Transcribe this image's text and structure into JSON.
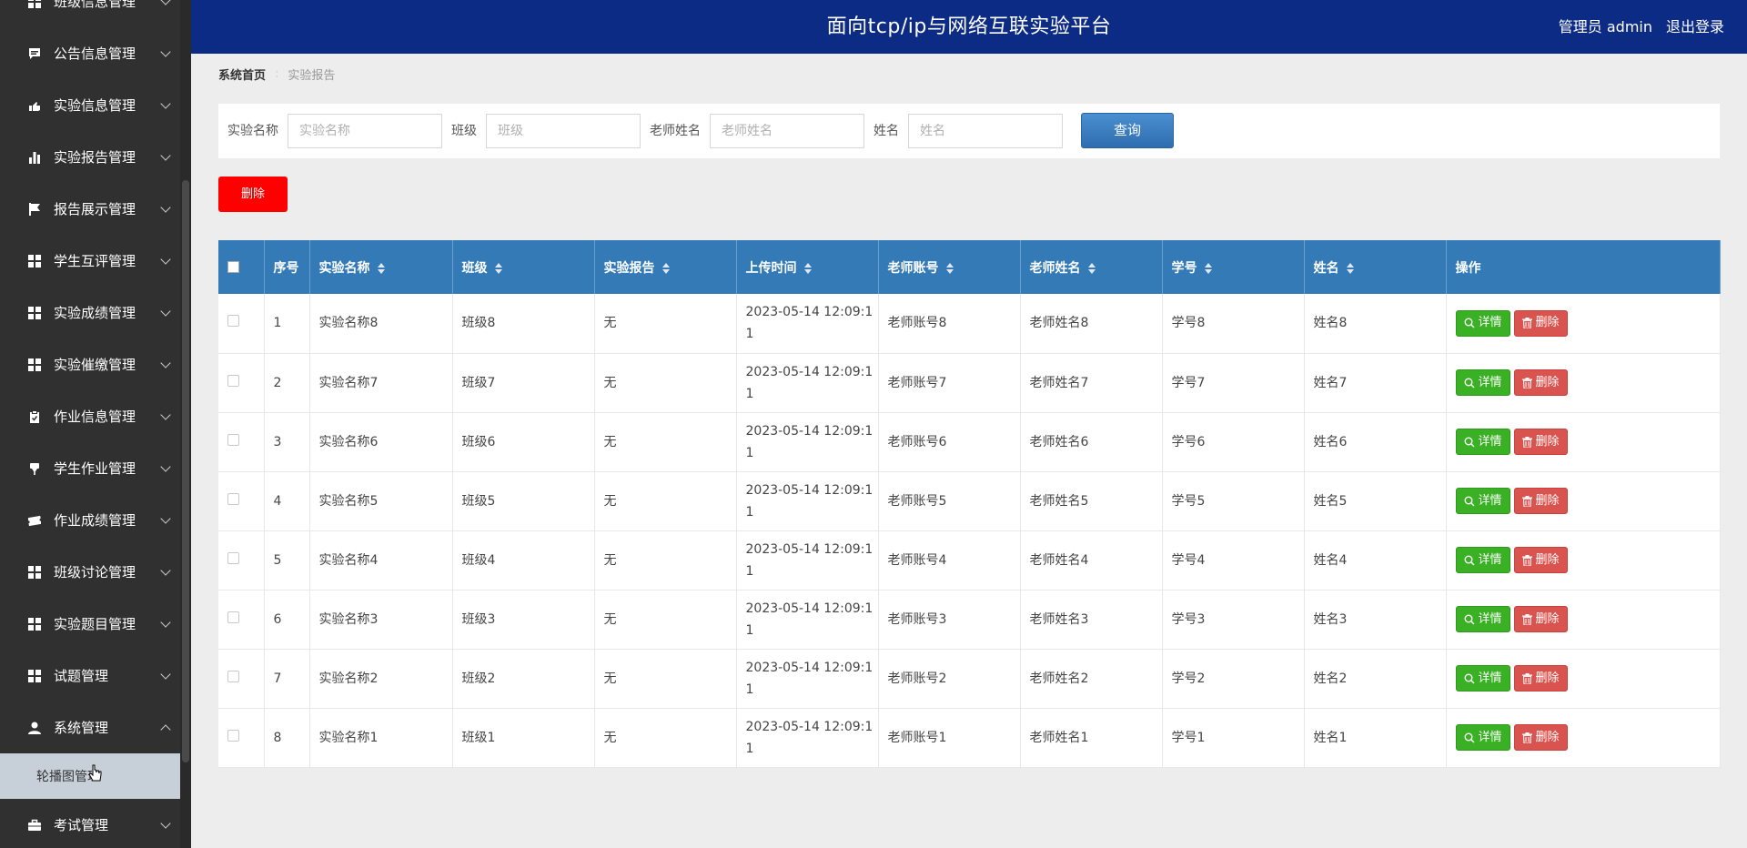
{
  "header": {
    "title": "面向tcp/ip与网络互联实验平台",
    "user": "管理员 admin",
    "logout": "退出登录"
  },
  "sidebar": {
    "items": [
      {
        "label": "班级信息管理",
        "icon": "grid-icon"
      },
      {
        "label": "公告信息管理",
        "icon": "chat-icon"
      },
      {
        "label": "实验信息管理",
        "icon": "hand-icon"
      },
      {
        "label": "实验报告管理",
        "icon": "bar-chart-icon"
      },
      {
        "label": "报告展示管理",
        "icon": "flag-icon"
      },
      {
        "label": "学生互评管理",
        "icon": "grid-icon"
      },
      {
        "label": "实验成绩管理",
        "icon": "grid-icon"
      },
      {
        "label": "实验催缴管理",
        "icon": "grid-icon"
      },
      {
        "label": "作业信息管理",
        "icon": "clipboard-icon"
      },
      {
        "label": "学生作业管理",
        "icon": "pushpin-icon"
      },
      {
        "label": "作业成绩管理",
        "icon": "ticket-icon"
      },
      {
        "label": "班级讨论管理",
        "icon": "grid-icon"
      },
      {
        "label": "实验题目管理",
        "icon": "grid-icon"
      },
      {
        "label": "试题管理",
        "icon": "grid-icon"
      },
      {
        "label": "系统管理",
        "icon": "user-icon",
        "expanded": true
      }
    ],
    "submenu": {
      "label": "轮播图管理"
    },
    "after": {
      "label": "考试管理",
      "icon": "briefcase-icon"
    }
  },
  "breadcrumb": {
    "home": "系统首页",
    "current": "实验报告"
  },
  "search": {
    "fields": [
      {
        "label": "实验名称",
        "placeholder": "实验名称"
      },
      {
        "label": "班级",
        "placeholder": "班级"
      },
      {
        "label": "老师姓名",
        "placeholder": "老师姓名"
      },
      {
        "label": "姓名",
        "placeholder": "姓名"
      }
    ],
    "query_button": "查询"
  },
  "toolbar": {
    "delete_label": "删除"
  },
  "table": {
    "headers": [
      "序号",
      "实验名称",
      "班级",
      "实验报告",
      "上传时间",
      "老师账号",
      "老师姓名",
      "学号",
      "姓名",
      "操作"
    ],
    "detail_label": "详情",
    "delete_label": "删除",
    "rows": [
      {
        "no": "1",
        "name": "实验名称8",
        "cls": "班级8",
        "report": "无",
        "time1": "2023-05-14 12:09:1",
        "time2": "1",
        "tacct": "老师账号8",
        "tname": "老师姓名8",
        "sno": "学号8",
        "sname": "姓名8"
      },
      {
        "no": "2",
        "name": "实验名称7",
        "cls": "班级7",
        "report": "无",
        "time1": "2023-05-14 12:09:1",
        "time2": "1",
        "tacct": "老师账号7",
        "tname": "老师姓名7",
        "sno": "学号7",
        "sname": "姓名7"
      },
      {
        "no": "3",
        "name": "实验名称6",
        "cls": "班级6",
        "report": "无",
        "time1": "2023-05-14 12:09:1",
        "time2": "1",
        "tacct": "老师账号6",
        "tname": "老师姓名6",
        "sno": "学号6",
        "sname": "姓名6"
      },
      {
        "no": "4",
        "name": "实验名称5",
        "cls": "班级5",
        "report": "无",
        "time1": "2023-05-14 12:09:1",
        "time2": "1",
        "tacct": "老师账号5",
        "tname": "老师姓名5",
        "sno": "学号5",
        "sname": "姓名5"
      },
      {
        "no": "5",
        "name": "实验名称4",
        "cls": "班级4",
        "report": "无",
        "time1": "2023-05-14 12:09:1",
        "time2": "1",
        "tacct": "老师账号4",
        "tname": "老师姓名4",
        "sno": "学号4",
        "sname": "姓名4"
      },
      {
        "no": "6",
        "name": "实验名称3",
        "cls": "班级3",
        "report": "无",
        "time1": "2023-05-14 12:09:1",
        "time2": "1",
        "tacct": "老师账号3",
        "tname": "老师姓名3",
        "sno": "学号3",
        "sname": "姓名3"
      },
      {
        "no": "7",
        "name": "实验名称2",
        "cls": "班级2",
        "report": "无",
        "time1": "2023-05-14 12:09:1",
        "time2": "1",
        "tacct": "老师账号2",
        "tname": "老师姓名2",
        "sno": "学号2",
        "sname": "姓名2"
      },
      {
        "no": "8",
        "name": "实验名称1",
        "cls": "班级1",
        "report": "无",
        "time1": "2023-05-14 12:09:1",
        "time2": "1",
        "tacct": "老师账号1",
        "tname": "老师姓名1",
        "sno": "学号1",
        "sname": "姓名1"
      }
    ]
  },
  "colors": {
    "header_bg": "#0c2b84",
    "sidebar_bg": "#303030",
    "table_header_bg": "#337ab7",
    "detail_green": "#3ab025",
    "delete_red": "#d9534f",
    "bulk_delete_red": "#ff0000"
  }
}
